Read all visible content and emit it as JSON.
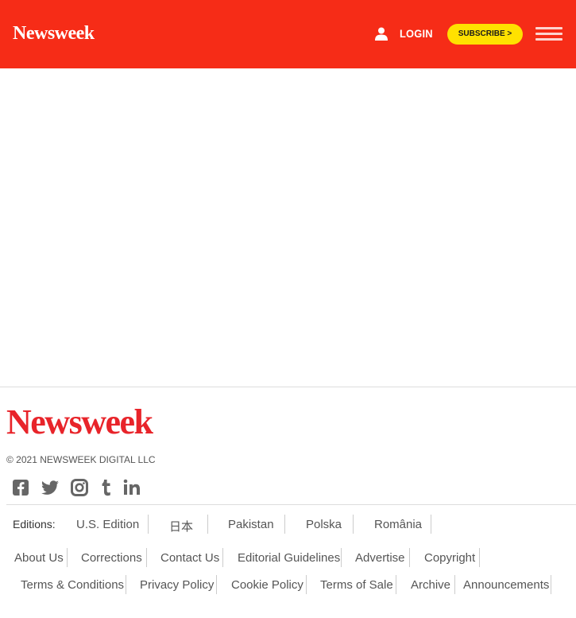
{
  "header": {
    "brand": "Newsweek",
    "login_label": "LOGIN",
    "subscribe_label": "SUBSCRIBE >",
    "background_color": "#f62c17",
    "subscribe_color": "#ffe100",
    "icons": [
      "user-icon",
      "hamburger-menu-icon"
    ]
  },
  "footer": {
    "logo": "Newsweek",
    "logo_color": "#e8242a",
    "copyright": "© 2021 NEWSWEEK DIGITAL LLC",
    "social_icons": [
      "facebook-icon",
      "twitter-icon",
      "instagram-icon",
      "tumblr-icon",
      "linkedin-icon"
    ],
    "editions_label": "Editions:",
    "editions": [
      "U.S. Edition",
      "日本",
      "Pakistan",
      "Polska",
      "România"
    ],
    "links_row1": [
      "About Us",
      "Corrections",
      "Contact Us",
      "Editorial Guidelines",
      "Advertise",
      "Copyright"
    ],
    "links_row2": [
      "Terms & Conditions",
      "Privacy Policy",
      "Cookie Policy",
      "Terms of Sale",
      "Archive",
      "Announcements"
    ]
  }
}
